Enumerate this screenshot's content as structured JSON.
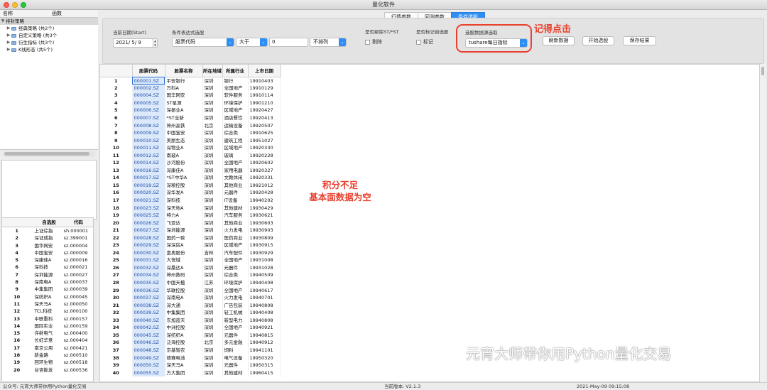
{
  "window": {
    "title": "量化软件"
  },
  "left_panel": {
    "headers": [
      "名称",
      "函数"
    ],
    "tree": [
      {
        "label": "排封策略",
        "level": 0,
        "expanded": true
      },
      {
        "label": "经典策略 (共2个)",
        "level": 1
      },
      {
        "label": "自定义策略 (共3个",
        "level": 1
      },
      {
        "label": "衍生指标 (共3个)",
        "level": 1
      },
      {
        "label": "K线形态 (共5个)",
        "level": 1
      }
    ],
    "code_table": {
      "headers": [
        "",
        "自选股",
        "代码"
      ],
      "rows": [
        [
          "1",
          "上证综指",
          "sh.000001"
        ],
        [
          "2",
          "深证成指",
          "sz.399001"
        ],
        [
          "3",
          "国华网安",
          "sz.000004"
        ],
        [
          "4",
          "中国宝安",
          "sz.000009"
        ],
        [
          "5",
          "深康佳A",
          "sz.000016"
        ],
        [
          "6",
          "深科技",
          "sz.000021"
        ],
        [
          "7",
          "深圳能源",
          "sz.000027"
        ],
        [
          "8",
          "深南电A",
          "sz.000037"
        ],
        [
          "9",
          "中集集团",
          "sz.000039"
        ],
        [
          "10",
          "深纺织A",
          "sz.000045"
        ],
        [
          "11",
          "深天马A",
          "sz.000050"
        ],
        [
          "12",
          "TCL科技",
          "sz.000100"
        ],
        [
          "13",
          "中联重科",
          "sz.000157"
        ],
        [
          "14",
          "国际实业",
          "sz.000159"
        ],
        [
          "15",
          "许继电气",
          "sz.000400"
        ],
        [
          "16",
          "长虹华意",
          "sz.000404"
        ],
        [
          "17",
          "南京公用",
          "sz.000421"
        ],
        [
          "18",
          "新金路",
          "sz.000510"
        ],
        [
          "19",
          "回环生物",
          "sz.000518"
        ],
        [
          "20",
          "甘咨勘发",
          "sz.000536"
        ]
      ]
    }
  },
  "tabs": [
    "行情参数",
    "回测参数",
    "条件选股"
  ],
  "active_tab": "条件选股",
  "form": {
    "date_label": "当前日期(Start)",
    "date_value": "2021/  5/  9",
    "expr_label": "条件表达式选股",
    "expr_field": "股票代码",
    "op_value": "大于",
    "num_value": "0",
    "sort_value": "不排列",
    "st_label": "是否剔除ST/*ST",
    "st_check": "剔除",
    "mark_label": "是否标记自选股",
    "mark_check": "标记",
    "source_label": "选股数据源选取",
    "source_value": "tushare每日指标",
    "btn_refresh": "刷新数据",
    "btn_start": "开始选股",
    "btn_save": "保存结果"
  },
  "annotations": {
    "remember": "记得点击",
    "note_line1": "积分不足",
    "note_line2": "基本面数据为空"
  },
  "table": {
    "headers": [
      "",
      "股票代码",
      "股票名称",
      "所在地域",
      "所属行业",
      "上市日期"
    ],
    "rows": [
      [
        "1",
        "000001.SZ",
        "平安银行",
        "深圳",
        "银行",
        "19910403"
      ],
      [
        "2",
        "000002.SZ",
        "万科A",
        "深圳",
        "全国地产",
        "19910129"
      ],
      [
        "3",
        "000004.SZ",
        "国华网安",
        "深圳",
        "软件服务",
        "19910114"
      ],
      [
        "4",
        "000005.SZ",
        "ST星源",
        "深圳",
        "环境保护",
        "19901210"
      ],
      [
        "5",
        "000006.SZ",
        "深振业A",
        "深圳",
        "区域地产",
        "19920427"
      ],
      [
        "6",
        "000007.SZ",
        "*ST全新",
        "深圳",
        "酒店餐饮",
        "19920413"
      ],
      [
        "7",
        "000008.SZ",
        "神州高铁",
        "北京",
        "运输设备",
        "19920507"
      ],
      [
        "8",
        "000009.SZ",
        "中国宝安",
        "深圳",
        "综合类",
        "19910625"
      ],
      [
        "9",
        "000010.SZ",
        "美丽生态",
        "深圳",
        "建筑工程",
        "19951027"
      ],
      [
        "10",
        "000011.SZ",
        "深物业A",
        "深圳",
        "区域地产",
        "19920330"
      ],
      [
        "11",
        "000012.SZ",
        "南玻A",
        "深圳",
        "玻璃",
        "19920228"
      ],
      [
        "12",
        "000014.SZ",
        "沙河股份",
        "深圳",
        "全国地产",
        "19920602"
      ],
      [
        "13",
        "000016.SZ",
        "深康佳A",
        "深圳",
        "家用电器",
        "19920327"
      ],
      [
        "14",
        "000017.SZ",
        "*ST中华A",
        "深圳",
        "文教休闲",
        "19920331"
      ],
      [
        "15",
        "000019.SZ",
        "深粮控股",
        "深圳",
        "其他商业",
        "19921012"
      ],
      [
        "16",
        "000020.SZ",
        "深华发A",
        "深圳",
        "元器件",
        "19920428"
      ],
      [
        "17",
        "000021.SZ",
        "深科技",
        "深圳",
        "IT设备",
        "19940202"
      ],
      [
        "18",
        "000023.SZ",
        "深天地A",
        "深圳",
        "其他建材",
        "19930429"
      ],
      [
        "19",
        "000025.SZ",
        "特力A",
        "深圳",
        "汽车服务",
        "19930621"
      ],
      [
        "20",
        "000026.SZ",
        "飞亚达",
        "深圳",
        "其他商业",
        "19930603"
      ],
      [
        "21",
        "000027.SZ",
        "深圳能源",
        "深圳",
        "火力发电",
        "19930903"
      ],
      [
        "22",
        "000028.SZ",
        "国药一致",
        "深圳",
        "医药商业",
        "19930809"
      ],
      [
        "23",
        "000029.SZ",
        "深深房A",
        "深圳",
        "区域地产",
        "19930915"
      ],
      [
        "24",
        "000030.SZ",
        "富奥股份",
        "吉林",
        "汽车配件",
        "19930929"
      ],
      [
        "25",
        "000031.SZ",
        "大悦城",
        "深圳",
        "全国地产",
        "19931008"
      ],
      [
        "26",
        "000032.SZ",
        "深桑达A",
        "深圳",
        "元器件",
        "19931028"
      ],
      [
        "27",
        "000034.SZ",
        "神州数码",
        "深圳",
        "综合类",
        "19940509"
      ],
      [
        "28",
        "000035.SZ",
        "中国天楹",
        "江苏",
        "环境保护",
        "19940408"
      ],
      [
        "29",
        "000036.SZ",
        "华联控股",
        "深圳",
        "全国地产",
        "19940617"
      ],
      [
        "30",
        "000037.SZ",
        "深南电A",
        "深圳",
        "火力发电",
        "19940701"
      ],
      [
        "31",
        "000038.SZ",
        "深大通",
        "深圳",
        "广告包装",
        "19940808"
      ],
      [
        "32",
        "000039.SZ",
        "中集集团",
        "深圳",
        "轻工机械",
        "19940408"
      ],
      [
        "33",
        "000040.SZ",
        "东旭蓝天",
        "深圳",
        "新型电力",
        "19940808"
      ],
      [
        "34",
        "000042.SZ",
        "中洲控股",
        "深圳",
        "全国地产",
        "19940921"
      ],
      [
        "35",
        "000045.SZ",
        "深纺织A",
        "深圳",
        "元器件",
        "19940815"
      ],
      [
        "36",
        "000046.SZ",
        "泛海控股",
        "北京",
        "多元金融",
        "19940912"
      ],
      [
        "37",
        "000048.SZ",
        "京基智农",
        "深圳",
        "饲料",
        "19941101"
      ],
      [
        "38",
        "000049.SZ",
        "德赛电池",
        "深圳",
        "电气设备",
        "19950320"
      ],
      [
        "39",
        "000050.SZ",
        "深天马A",
        "深圳",
        "元器件",
        "19950315"
      ],
      [
        "40",
        "000055.SZ",
        "方大集团",
        "深圳",
        "其他建材",
        "19960415"
      ]
    ]
  },
  "watermark": "元宵大师带你用Python量化交易",
  "status": {
    "left": "公众号: 元宵大师带你用Python量化交易",
    "version": "当前版本: V2.1.3",
    "datetime": "2021-May-09 09:15:08"
  }
}
